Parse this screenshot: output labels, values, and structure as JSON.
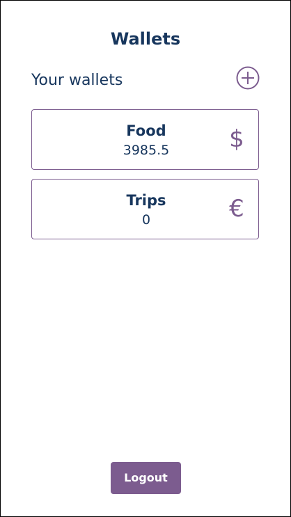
{
  "header": {
    "title": "Wallets"
  },
  "wallets_section": {
    "label": "Your wallets",
    "add_icon": "plus-circle-icon"
  },
  "wallets": [
    {
      "name": "Food",
      "balance": "3985.5",
      "currency_symbol": "$",
      "currency_icon": "dollar-icon"
    },
    {
      "name": "Trips",
      "balance": "0",
      "currency_symbol": "€",
      "currency_icon": "euro-icon"
    }
  ],
  "footer": {
    "logout_label": "Logout"
  },
  "colors": {
    "primary_text": "#17365d",
    "accent": "#7c5c8f",
    "background": "#ffffff"
  }
}
